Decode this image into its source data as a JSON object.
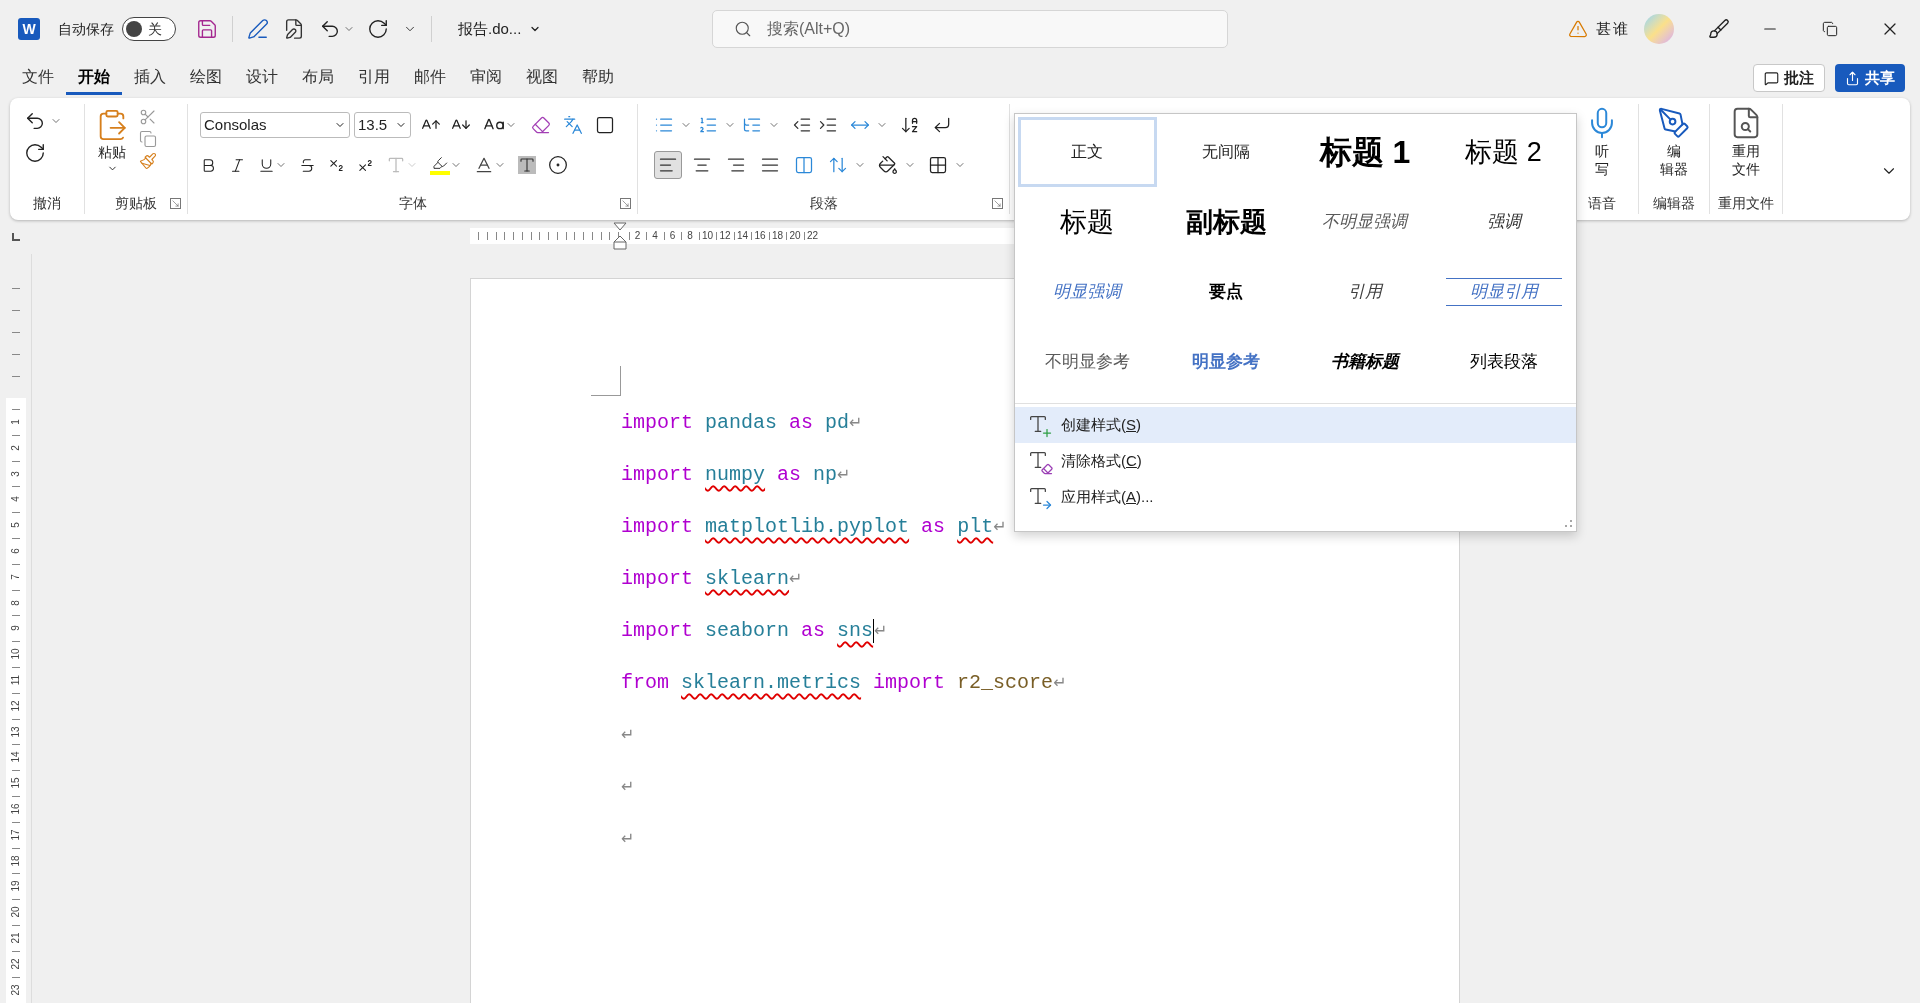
{
  "app_icon": {
    "letter": "W"
  },
  "title_bar": {
    "autosave_label": "自动保存",
    "autosave": {
      "on": false,
      "state_label": "关"
    },
    "document_name": "报告.do...",
    "search": {
      "placeholder": "搜索(Alt+Q)"
    },
    "user_name": "甚谁"
  },
  "menu_tabs": [
    {
      "label": "文件",
      "selected": false
    },
    {
      "label": "开始",
      "selected": true
    },
    {
      "label": "插入",
      "selected": false
    },
    {
      "label": "绘图",
      "selected": false
    },
    {
      "label": "设计",
      "selected": false
    },
    {
      "label": "布局",
      "selected": false
    },
    {
      "label": "引用",
      "selected": false
    },
    {
      "label": "邮件",
      "selected": false
    },
    {
      "label": "审阅",
      "selected": false
    },
    {
      "label": "视图",
      "selected": false
    },
    {
      "label": "帮助",
      "selected": false
    }
  ],
  "actions": {
    "comments": "批注",
    "share": "共享"
  },
  "ribbon": {
    "undo": {
      "label": "撤消"
    },
    "clipboard": {
      "label": "剪贴板",
      "paste": "粘贴"
    },
    "font": {
      "label": "字体",
      "name": "Consolas",
      "size": "13.5"
    },
    "paragraph": {
      "label": "段落",
      "alignments": [
        {
          "kind": "left",
          "selected": true
        },
        {
          "kind": "center",
          "selected": false
        },
        {
          "kind": "right",
          "selected": false
        },
        {
          "kind": "justify",
          "selected": false
        },
        {
          "kind": "distributed",
          "selected": false
        }
      ]
    },
    "voice": {
      "label": "语音",
      "button_lines": [
        "听",
        "写"
      ]
    },
    "editor": {
      "label": "编辑器",
      "button_lines": [
        "编",
        "辑器"
      ]
    },
    "reuse": {
      "label": "重用文件",
      "button_lines": [
        "重用",
        "文件"
      ]
    }
  },
  "rulers": {
    "horizontal": [
      "2",
      "4",
      "6",
      "8",
      "10",
      "12",
      "14",
      "16",
      "18",
      "20",
      "22"
    ],
    "vertical": [
      "1",
      "2",
      "3",
      "4",
      "5",
      "6",
      "7",
      "8",
      "9",
      "10",
      "11",
      "12",
      "13",
      "14",
      "15",
      "16",
      "17",
      "18",
      "19",
      "20",
      "21",
      "22",
      "23"
    ]
  },
  "document": {
    "lines": [
      {
        "tokens": [
          {
            "text": "import",
            "kind": "keyword",
            "misspelled": false
          },
          {
            "text": "pandas",
            "kind": "module",
            "misspelled": false
          },
          {
            "text": "as",
            "kind": "keyword",
            "misspelled": false
          },
          {
            "text": "pd",
            "kind": "module",
            "misspelled": false
          }
        ],
        "end_mark": "↵",
        "cursor": false
      },
      {
        "tokens": [
          {
            "text": "import",
            "kind": "keyword",
            "misspelled": false
          },
          {
            "text": "numpy",
            "kind": "module",
            "misspelled": true
          },
          {
            "text": "as",
            "kind": "keyword",
            "misspelled": false
          },
          {
            "text": "np",
            "kind": "module",
            "misspelled": false
          }
        ],
        "end_mark": "↵",
        "cursor": false
      },
      {
        "tokens": [
          {
            "text": "import",
            "kind": "keyword",
            "misspelled": false
          },
          {
            "text": "matplotlib.pyplot",
            "kind": "module",
            "misspelled": true
          },
          {
            "text": "as",
            "kind": "keyword",
            "misspelled": false
          },
          {
            "text": "plt",
            "kind": "module",
            "misspelled": true
          }
        ],
        "end_mark": "↵",
        "cursor": false
      },
      {
        "tokens": [
          {
            "text": "import",
            "kind": "keyword",
            "misspelled": false
          },
          {
            "text": "sklearn",
            "kind": "module",
            "misspelled": true
          }
        ],
        "end_mark": "↵",
        "cursor": false
      },
      {
        "tokens": [
          {
            "text": "import",
            "kind": "keyword",
            "misspelled": false
          },
          {
            "text": "seaborn",
            "kind": "module",
            "misspelled": false
          },
          {
            "text": "as",
            "kind": "keyword",
            "misspelled": false
          },
          {
            "text": "sns",
            "kind": "module",
            "misspelled": true
          }
        ],
        "end_mark": "↵",
        "cursor": true
      },
      {
        "tokens": [
          {
            "text": "from",
            "kind": "keyword",
            "misspelled": false
          },
          {
            "text": "sklearn.metrics",
            "kind": "module",
            "misspelled": true
          },
          {
            "text": "import",
            "kind": "keyword",
            "misspelled": false
          },
          {
            "text": "r2_score",
            "kind": "function",
            "misspelled": false
          }
        ],
        "end_mark": "↵",
        "cursor": false
      },
      {
        "end_mark": "↵",
        "cursor": false
      },
      {
        "end_mark": "↵",
        "cursor": false
      },
      {
        "end_mark": "↵",
        "cursor": false
      }
    ]
  },
  "styles_gallery": {
    "items": [
      {
        "label": "正文",
        "kind": "normal",
        "selected": true
      },
      {
        "label": "无间隔",
        "kind": "no-spacing",
        "selected": false
      },
      {
        "label": "标题 1",
        "kind": "heading1",
        "selected": false
      },
      {
        "label": "标题 2",
        "kind": "heading2",
        "selected": false
      },
      {
        "label": "标题",
        "kind": "title",
        "selected": false
      },
      {
        "label": "副标题",
        "kind": "subtitle",
        "selected": false
      },
      {
        "label": "不明显强调",
        "kind": "subtle-emphasis",
        "selected": false
      },
      {
        "label": "强调",
        "kind": "emphasis",
        "selected": false
      },
      {
        "label": "明显强调",
        "kind": "intense-emphasis",
        "selected": false
      },
      {
        "label": "要点",
        "kind": "strong",
        "selected": false
      },
      {
        "label": "引用",
        "kind": "quote",
        "selected": false
      },
      {
        "label": "明显引用",
        "kind": "intense-quote",
        "selected": false
      },
      {
        "label": "不明显参考",
        "kind": "subtle-reference",
        "selected": false
      },
      {
        "label": "明显参考",
        "kind": "intense-reference",
        "selected": false
      },
      {
        "label": "书籍标题",
        "kind": "book-title",
        "selected": false
      },
      {
        "label": "列表段落",
        "kind": "list-paragraph",
        "selected": false
      }
    ],
    "menu": [
      {
        "text": "创建样式(",
        "access_key": "S",
        "text_after": ")",
        "kind": "create",
        "selected": true
      },
      {
        "text": "清除格式(",
        "access_key": "C",
        "text_after": ")",
        "kind": "clear",
        "selected": false
      },
      {
        "text": "应用样式(",
        "access_key": "A",
        "text_after": ")...",
        "kind": "apply",
        "selected": false
      }
    ]
  }
}
